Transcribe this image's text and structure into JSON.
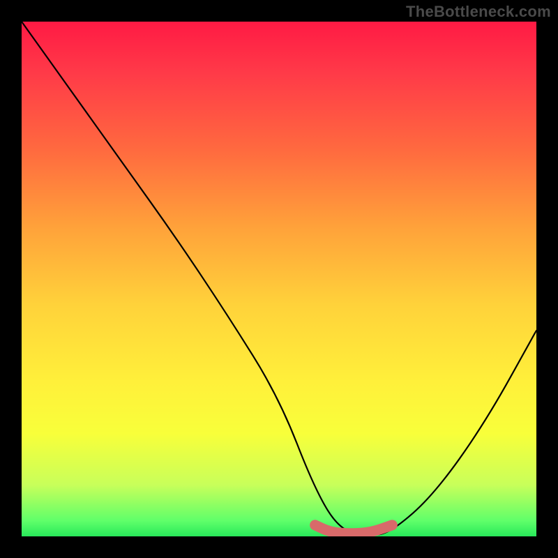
{
  "watermark": "TheBottleneck.com",
  "chart_data": {
    "type": "line",
    "title": "",
    "xlabel": "",
    "ylabel": "",
    "xlim": [
      0,
      100
    ],
    "ylim": [
      0,
      100
    ],
    "series": [
      {
        "name": "bottleneck-curve",
        "x": [
          0,
          10,
          20,
          30,
          40,
          50,
          57,
          62,
          68,
          72,
          80,
          90,
          100
        ],
        "y": [
          100,
          86,
          72,
          58,
          43,
          27,
          9,
          1,
          0,
          1,
          8,
          22,
          40
        ],
        "color": "#000000"
      },
      {
        "name": "optimal-range-highlight",
        "x": [
          57,
          60,
          64,
          68,
          72
        ],
        "y": [
          2.2,
          0.8,
          0.5,
          0.8,
          2.2
        ],
        "color": "#d86a6a"
      }
    ],
    "gradient_stops": [
      {
        "pos": 0.0,
        "color": "#ff1a44"
      },
      {
        "pos": 0.1,
        "color": "#ff3a48"
      },
      {
        "pos": 0.25,
        "color": "#ff6a3f"
      },
      {
        "pos": 0.4,
        "color": "#ffa23a"
      },
      {
        "pos": 0.55,
        "color": "#ffd23a"
      },
      {
        "pos": 0.7,
        "color": "#fff03a"
      },
      {
        "pos": 0.8,
        "color": "#f8ff3a"
      },
      {
        "pos": 0.9,
        "color": "#c8ff5a"
      },
      {
        "pos": 0.97,
        "color": "#5fff6a"
      },
      {
        "pos": 1.0,
        "color": "#28e85a"
      }
    ]
  }
}
